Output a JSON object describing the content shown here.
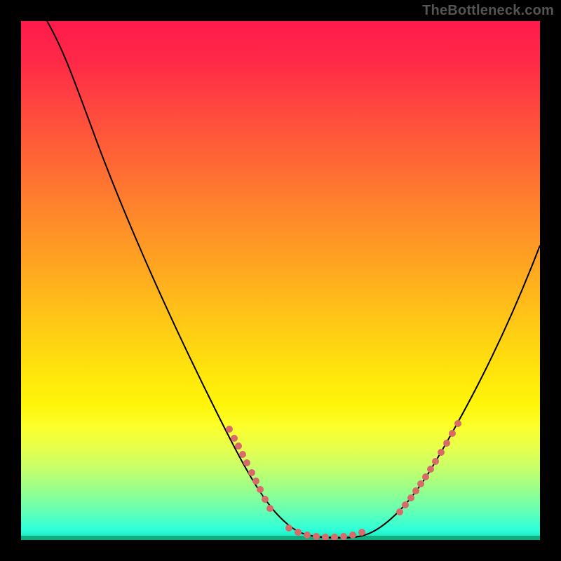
{
  "watermark": "TheBottleneck.com",
  "colors": {
    "curve": "#000000",
    "dots": "#d96a6a",
    "frame_bg": "#000000"
  },
  "chart_data": {
    "type": "line",
    "title": "",
    "xlabel": "",
    "ylabel": "",
    "xlim": [
      0,
      100
    ],
    "ylim": [
      0,
      100
    ],
    "grid": false,
    "legend": false,
    "series": [
      {
        "name": "bottleneck-curve",
        "x": [
          5,
          10,
          15,
          20,
          25,
          30,
          35,
          40,
          45,
          48,
          50,
          52,
          55,
          58,
          60,
          63,
          65,
          70,
          75,
          80,
          85,
          90,
          95,
          100
        ],
        "y": [
          100,
          92,
          83,
          73,
          62,
          50,
          38,
          27,
          16,
          10,
          6,
          3,
          1,
          0,
          0,
          0,
          1,
          4,
          10,
          18,
          27,
          37,
          47,
          57
        ]
      }
    ],
    "highlight_points": {
      "name": "dotted-band",
      "approx_y_range": [
        0,
        22
      ],
      "left_cluster_x": [
        40,
        41,
        42,
        43,
        44,
        45,
        46
      ],
      "bottom_cluster_x": [
        52,
        54,
        56,
        58,
        60,
        62,
        64,
        66
      ],
      "right_cluster_x": [
        72,
        73,
        74,
        75,
        76,
        77,
        78,
        79,
        80,
        81
      ]
    },
    "gradient_note": "vertical rainbow red(top) -> orange -> yellow -> green(bottom)"
  }
}
